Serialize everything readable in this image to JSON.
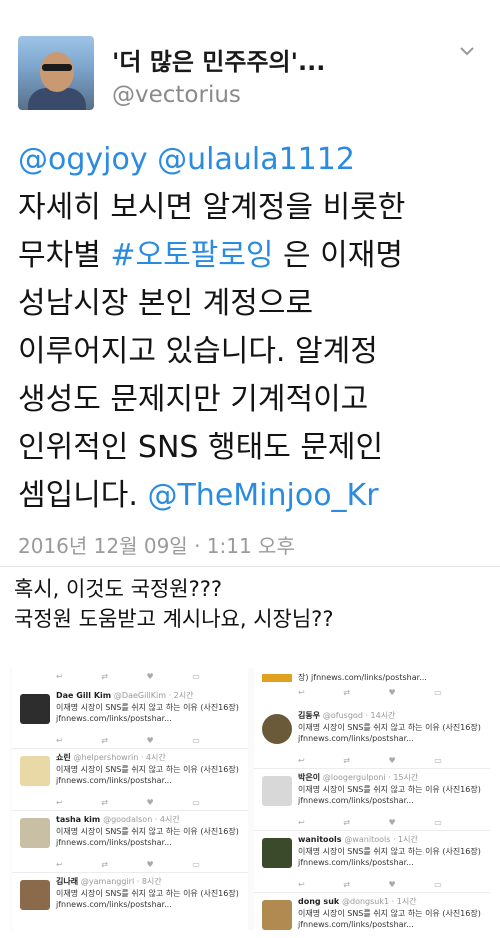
{
  "tweet": {
    "display_name": "'더 많은 민주주의'...",
    "handle": "@vectorius",
    "mentions": "@ogyjoy @ulaula1112",
    "text_line1": "자세히 보시면 알계정을 비롯한",
    "text_line2_pre": "무차별 ",
    "hashtag": "#오토팔로잉",
    "text_line2_post": " 은 이재명",
    "text_line3": "성남시장 본인 계정으로",
    "text_line4": "이루어지고 있습니다. 알계정",
    "text_line5": "생성도 문제지만 기계적이고",
    "text_line6": "인위적인 SNS 행태도 문제인",
    "text_line7_pre": "셈입니다. ",
    "mention_end": "@TheMinjoo_Kr",
    "timestamp": "2016년 12월 09일 · 1:11 오후"
  },
  "reply": {
    "line1": "혹시, 이것도 국정원???",
    "line2": "국정원 도움받고 계시나요, 시장님??"
  },
  "icons": {
    "menu": "chevron-down-icon",
    "avatar": "avatar"
  },
  "embedded": {
    "common_text": "이재명 시장이 SNS를 쉬지 않고 하는 이유 (사진16장) jfnnews.com/links/postshar...",
    "top_link": "장) jfnnews.com/links/postshar...",
    "action_icons": "↩ ⇄ ♥ ▭",
    "left": [
      {
        "name": "Dae Gill Kim",
        "handle": "@DaeGillKim · 2시간"
      },
      {
        "name": "쇼린",
        "handle": "@helpershowrin · 4시간"
      },
      {
        "name": "tasha kim",
        "handle": "@goodalson · 4시간"
      },
      {
        "name": "김나래",
        "handle": "@yamanggirl · 8시간"
      }
    ],
    "right": [
      {
        "name": "김동우",
        "handle": "@ofusgod · 14시간"
      },
      {
        "name": "박은이",
        "handle": "@loogergulponi · 15시간"
      },
      {
        "name": "wanitools",
        "handle": "@wanitools · 1시간"
      },
      {
        "name": "dong suk",
        "handle": "@dongsuk1 · 1시간"
      }
    ]
  }
}
